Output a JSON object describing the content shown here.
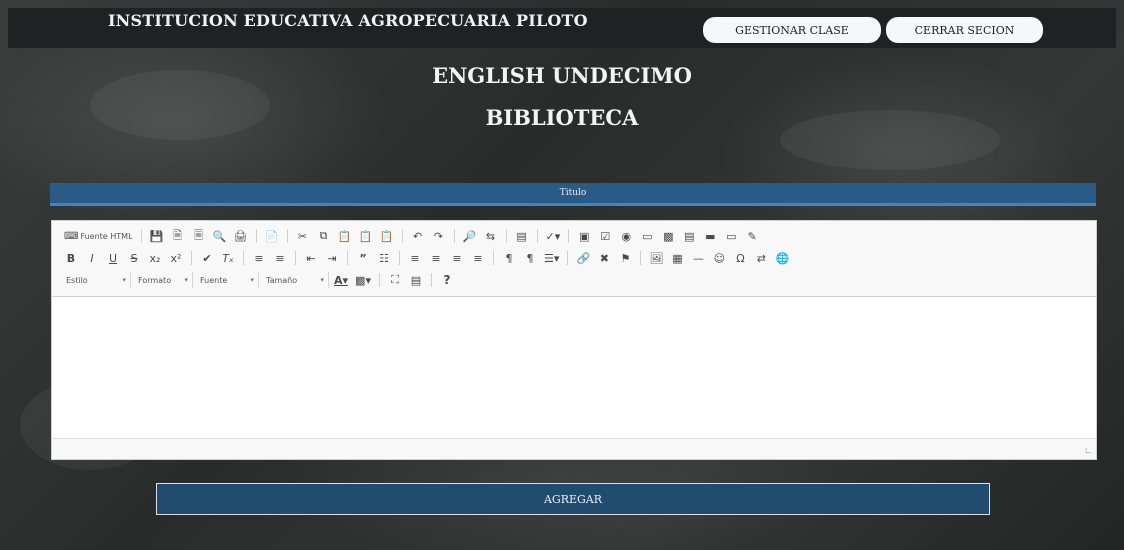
{
  "header": {
    "school_name": "INSTITUCION EDUCATIVA AGROPECUARIA PILOTO",
    "buttons": {
      "manage_class": "GESTIONAR CLASE",
      "logout": "CERRAR SECION"
    }
  },
  "page": {
    "course_title": "ENGLISH UNDECIMO",
    "section_title": "BIBLIOTECA"
  },
  "title_field": {
    "label": "Titulo"
  },
  "editor": {
    "toolbar": {
      "source_label": "Fuente HTML",
      "combos": {
        "style": "Estilo",
        "format": "Formato",
        "font": "Fuente",
        "size": "Tamaño"
      },
      "help_label": "?"
    }
  },
  "actions": {
    "add_button": "AGREGAR"
  },
  "colors": {
    "header_bar": "#1f2222",
    "title_bar": "#2a5a86",
    "add_button": "#224b70"
  }
}
